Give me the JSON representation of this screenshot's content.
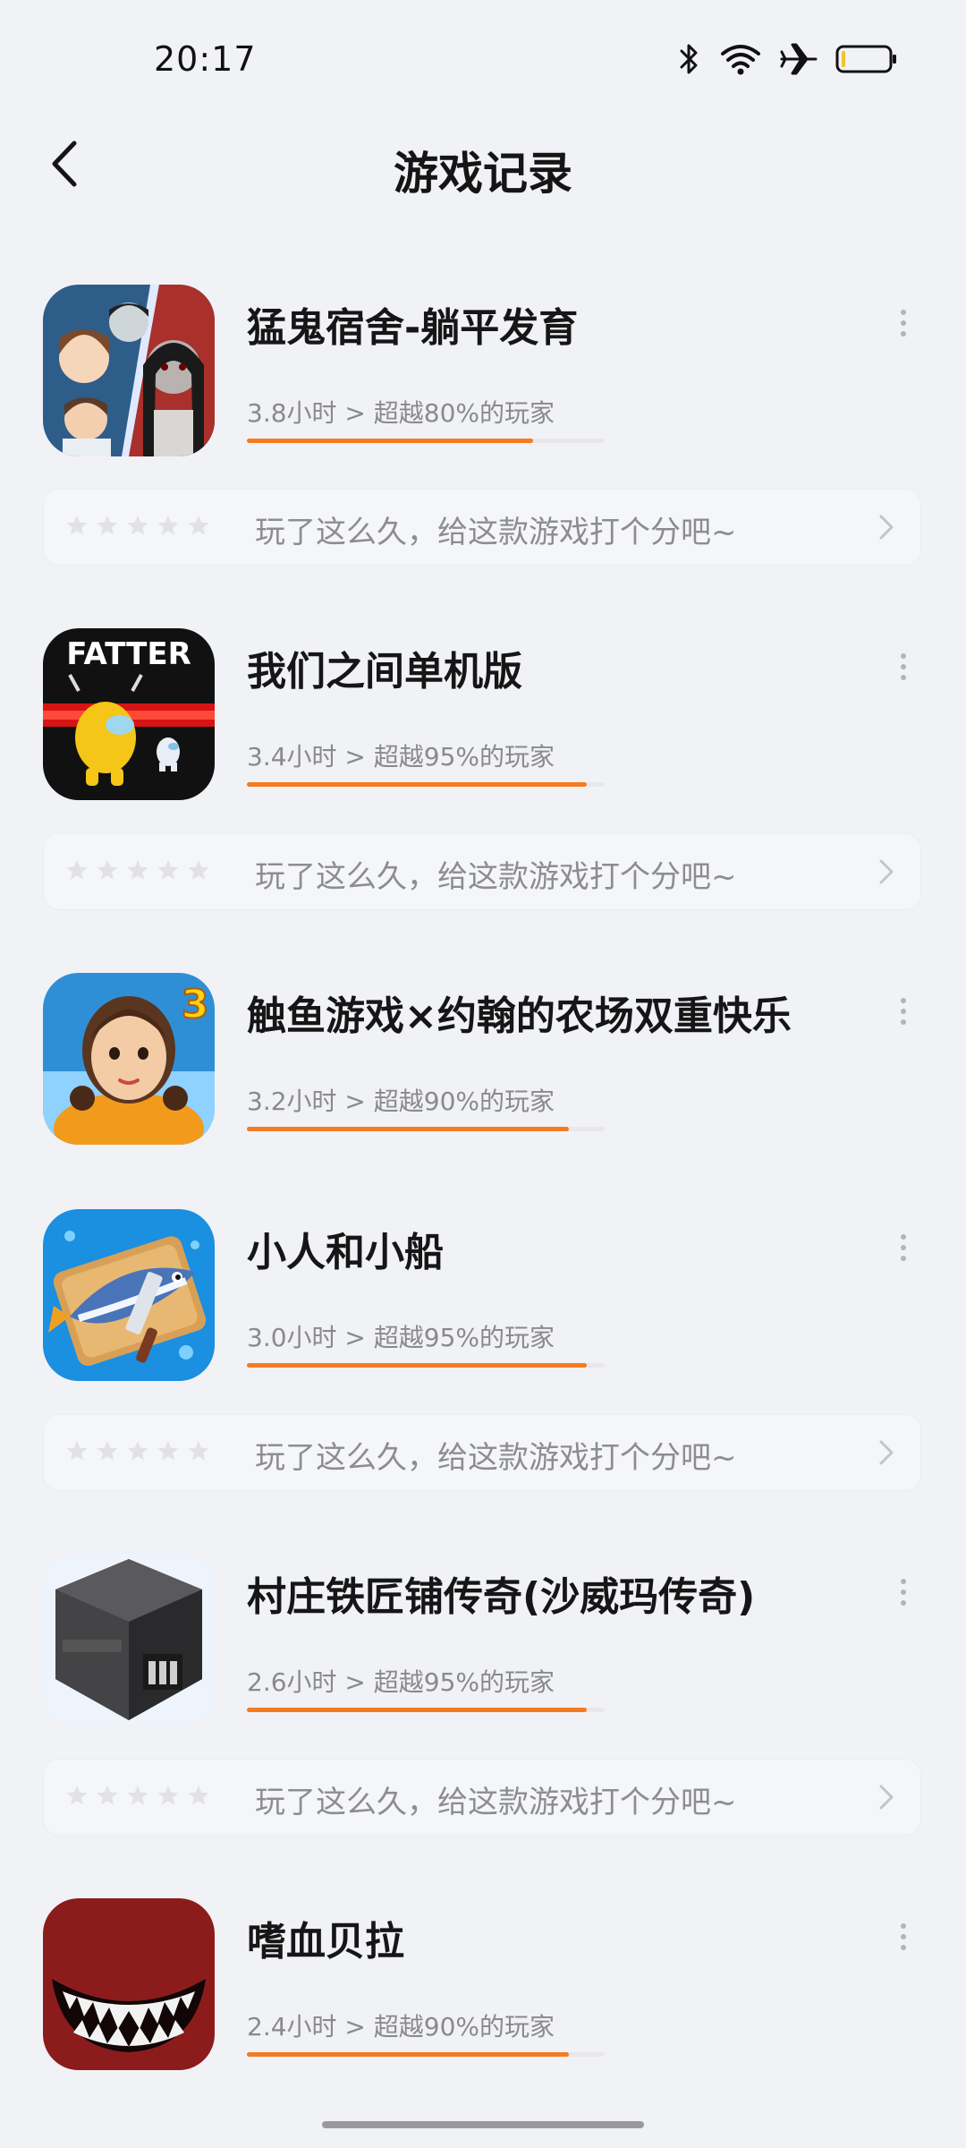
{
  "status_bar": {
    "time": "20:17",
    "icons": [
      "bluetooth-icon",
      "wifi-icon",
      "airplane-icon",
      "battery-icon"
    ]
  },
  "header": {
    "title": "游戏记录",
    "back_icon": "chevron-left-icon"
  },
  "rating_prompt": "玩了这么久，给这款游戏打个分吧~",
  "games": [
    {
      "name": "猛鬼宿舍-躺平发育",
      "stats": "3.8小时 > 超越80%的玩家",
      "progress": 0.8,
      "has_rating_row": true,
      "icon": "ghost-dorm-game-icon"
    },
    {
      "name": "我们之间单机版",
      "stats": "3.4小时 > 超越95%的玩家",
      "progress": 0.95,
      "has_rating_row": true,
      "icon": "among-us-game-icon",
      "icon_text": "FATTER"
    },
    {
      "name": "触鱼游戏×约翰的农场双重快乐",
      "stats": "3.2小时 > 超越90%的玩家",
      "progress": 0.9,
      "has_rating_row": false,
      "icon": "doll-game-icon",
      "icon_text": "3"
    },
    {
      "name": "小人和小船",
      "stats": "3.0小时 > 超越95%的玩家",
      "progress": 0.95,
      "has_rating_row": true,
      "icon": "fish-board-game-icon"
    },
    {
      "name": "村庄铁匠铺传奇(沙威玛传奇)",
      "stats": "2.6小时 > 超越95%的玩家",
      "progress": 0.95,
      "has_rating_row": true,
      "icon": "furnace-block-game-icon"
    },
    {
      "name": "嗜血贝拉",
      "stats": "2.4小时 > 超越90%的玩家",
      "progress": 0.9,
      "has_rating_row": false,
      "icon": "grin-monster-game-icon"
    }
  ],
  "colors": {
    "background": "#f1f2f6",
    "accent": "#f47b20",
    "title_text": "#161616",
    "secondary_text": "#8a8a8a"
  }
}
